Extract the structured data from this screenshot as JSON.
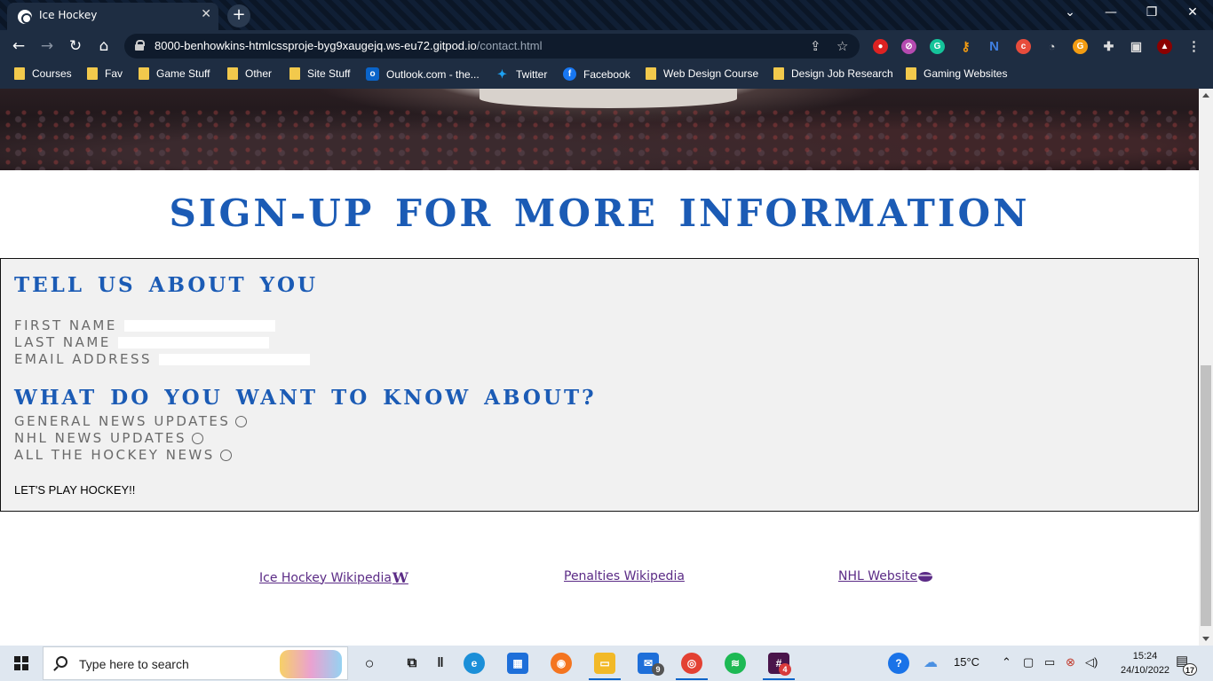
{
  "browser": {
    "tab_title": "Ice Hockey",
    "tab_close": "✕",
    "new_tab": "+",
    "url_host": "8000-benhowkins-htmlcssproje-byg9xaugejq.ws-eu72.gitpod.io",
    "url_path": "/contact.html",
    "window_controls": {
      "list": "⌄",
      "minimize": "—",
      "restore": "❐",
      "close": "✕"
    },
    "nav": {
      "back": "←",
      "forward": "→",
      "reload": "↻",
      "home": "⌂"
    },
    "extensions": [
      "ublock",
      "privacy",
      "grammarly",
      "key",
      "N",
      "c",
      "cast",
      "G",
      "puzzle",
      "sidebar",
      "assassin"
    ],
    "menu": "⋮"
  },
  "bookmarks": [
    {
      "label": "Courses",
      "icon": "folder-icon"
    },
    {
      "label": "Fav",
      "icon": "folder-icon"
    },
    {
      "label": "Game Stuff",
      "icon": "folder-icon"
    },
    {
      "label": "Other",
      "icon": "folder-icon"
    },
    {
      "label": "Site Stuff",
      "icon": "folder-icon"
    },
    {
      "label": "Outlook.com - the...",
      "icon": "outlook-icon"
    },
    {
      "label": "Twitter",
      "icon": "twitter-icon"
    },
    {
      "label": "Facebook",
      "icon": "facebook-icon"
    },
    {
      "label": "Web Design Course",
      "icon": "folder-icon"
    },
    {
      "label": "Design Job Research",
      "icon": "folder-icon"
    },
    {
      "label": "Gaming Websites",
      "icon": "folder-icon"
    }
  ],
  "page": {
    "title": "SIGN-UP FOR MORE INFORMATION",
    "form": {
      "heading_about": "TELL US ABOUT YOU",
      "fields": [
        {
          "label": "FIRST NAME",
          "value": ""
        },
        {
          "label": "LAST NAME",
          "value": ""
        },
        {
          "label": "EMAIL ADDRESS",
          "value": ""
        }
      ],
      "heading_interests": "WHAT DO YOU WANT TO KNOW ABOUT?",
      "options": [
        {
          "label": "GENERAL NEWS UPDATES",
          "checked": false
        },
        {
          "label": "NHL NEWS UPDATES",
          "checked": false
        },
        {
          "label": "ALL THE HOCKEY NEWS",
          "checked": false
        }
      ],
      "submit_label": "LET'S PLAY HOCKEY!!"
    },
    "footer_links": [
      {
        "label": "Ice Hockey Wikipedia",
        "icon": "wikipedia-icon",
        "icon_text": "W"
      },
      {
        "label": "Penalties Wikipedia"
      },
      {
        "label": "NHL Website",
        "icon": "hockey-puck-icon"
      }
    ]
  },
  "taskbar": {
    "search_placeholder": "Type here to search",
    "mail_badge": "9",
    "slack_badge": "4",
    "weather_temp": "15°C",
    "time": "15:24",
    "date": "24/10/2022",
    "notification_count": "17"
  },
  "colors": {
    "heading_blue": "#1b5bb5",
    "link_purple": "#5b2b86",
    "form_bg": "#f1f1f1",
    "chrome_dark": "#1e2d42"
  }
}
